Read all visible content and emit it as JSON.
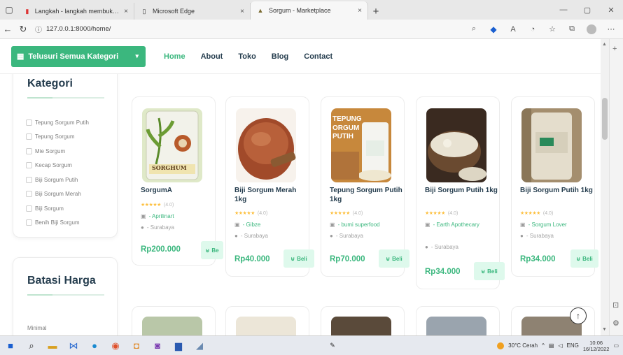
{
  "browser": {
    "tabs": [
      {
        "title": "Langkah - langkah membuka aplikasi",
        "close": "×"
      },
      {
        "title": "Microsoft Edge",
        "close": "×"
      },
      {
        "title": "Sorgum - Marketplace",
        "close": "×"
      }
    ],
    "new_tab": "+",
    "url": "127.0.0.1:8000/home/",
    "window_controls": {
      "minimize": "—",
      "maximize": "▢",
      "close": "✕"
    }
  },
  "header": {
    "category_button": "Telusuri Semua Kategori",
    "nav": [
      "Home",
      "About",
      "Toko",
      "Blog",
      "Contact"
    ],
    "active_nav": "Home"
  },
  "sidebar": {
    "category_title": "Kategori",
    "categories": [
      "Tepung Sorgum Putih",
      "Tepung Sorgum",
      "Mie Sorgum",
      "Kecap Sorgum",
      "Biji Sorgum Putih",
      "Biji Sorgum Merah",
      "Biji Sorgum",
      "Benih Biji Sorgum"
    ],
    "price_title": "Batasi Harga",
    "price_min_label": "Minimal"
  },
  "products": [
    {
      "name": "SorgumA",
      "rating": "(4.0)",
      "seller": "- Aprilinart",
      "location": "- Surabaya",
      "price": "Rp200.000",
      "buy": "Be"
    },
    {
      "name": "Biji Sorgum Merah 1kg",
      "rating": "(4.0)",
      "seller": "- Gibze",
      "location": "- Surabaya",
      "price": "Rp40.000",
      "buy": "Beli"
    },
    {
      "name": "Tepung Sorgum Putih 1kg",
      "rating": "(4.0)",
      "seller": "- bumi superfood",
      "location": "- Surabaya",
      "price": "Rp70.000",
      "buy": "Beli"
    },
    {
      "name": "Biji Sorgum Putih 1kg",
      "rating": "(4.0)",
      "seller": "- Earth Apothecary",
      "location": "- Surabaya",
      "price": "Rp34.000",
      "buy": "Beli"
    },
    {
      "name": "Biji Sorgum Putih 1kg",
      "rating": "(4.0)",
      "seller": "- Sorgum Lover",
      "location": "- Surabaya",
      "price": "Rp34.000",
      "buy": "Beli"
    }
  ],
  "package_texts": {
    "sorghum_label": "SORGHUM",
    "tepung_lines": [
      "TEPUNG",
      "ORGUM",
      "PUTIH"
    ]
  },
  "taskbar": {
    "weather": "30°C Cerah",
    "language": "ENG",
    "time": "10:06",
    "date": "16/12/2022"
  },
  "colors": {
    "brand": "#3bb77e",
    "heading": "#253d4e",
    "star": "#fdc040"
  }
}
